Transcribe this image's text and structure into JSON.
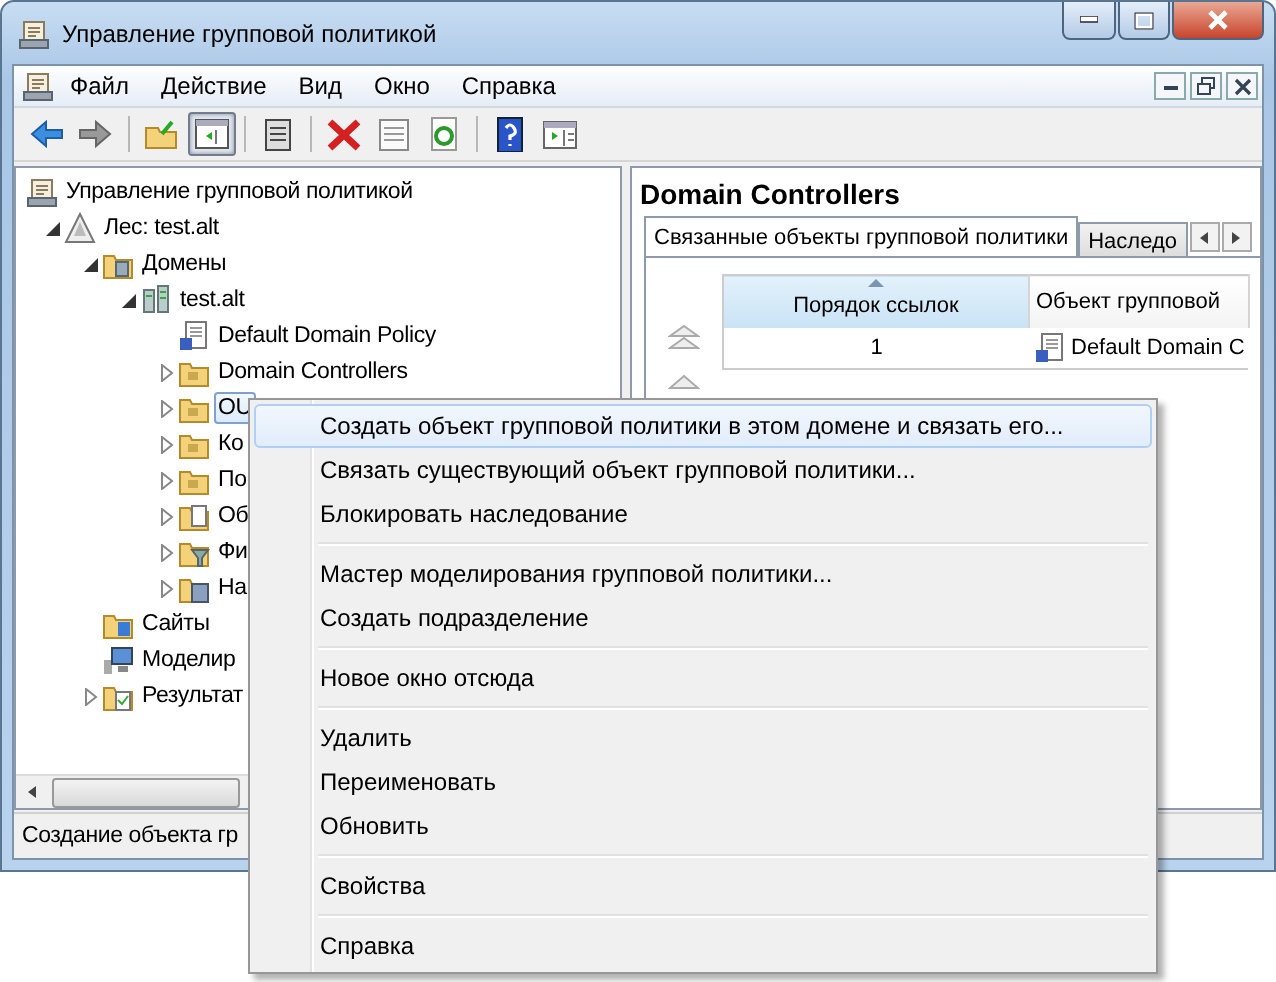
{
  "window": {
    "title": "Управление групповой политикой"
  },
  "menu_bar": [
    "Файл",
    "Действие",
    "Вид",
    "Окно",
    "Справка"
  ],
  "toolbar": [
    {
      "kind": "back",
      "pressed": false
    },
    {
      "kind": "forward",
      "pressed": false
    },
    {
      "kind": "up",
      "pressed": false
    },
    {
      "kind": "tree",
      "pressed": true
    },
    {
      "kind": "clipboard",
      "pressed": false
    },
    {
      "kind": "delete",
      "pressed": false
    },
    {
      "kind": "properties",
      "pressed": false
    },
    {
      "kind": "refresh",
      "pressed": false
    },
    {
      "kind": "help",
      "pressed": false
    },
    {
      "kind": "action-pane",
      "pressed": false
    }
  ],
  "tree": [
    {
      "label": "Управление групповой политикой",
      "kind": "console",
      "selected": false,
      "children": [
        {
          "label": "Лес: test.alt",
          "kind": "forest",
          "selected": false,
          "expanded": true,
          "children": [
            {
              "label": "Домены",
              "kind": "domains",
              "selected": false,
              "expanded": true,
              "children": [
                {
                  "label": "test.alt",
                  "kind": "domain",
                  "selected": false,
                  "expanded": true,
                  "children": [
                    {
                      "label": "Default Domain Policy",
                      "kind": "gpo",
                      "selected": false
                    },
                    {
                      "label": "Domain Controllers",
                      "kind": "ou",
                      "selected": false,
                      "expanded": false
                    },
                    {
                      "label": "OU",
                      "kind": "ou",
                      "selected": true,
                      "expanded": false
                    },
                    {
                      "label": "Ко",
                      "kind": "ou",
                      "selected": false,
                      "expanded": false
                    },
                    {
                      "label": "По",
                      "kind": "ou",
                      "selected": false,
                      "expanded": false
                    },
                    {
                      "label": "Об",
                      "kind": "doc-folder",
                      "selected": false,
                      "expanded": false
                    },
                    {
                      "label": "Фи",
                      "kind": "filter-folder",
                      "selected": false,
                      "expanded": false
                    },
                    {
                      "label": "На",
                      "kind": "wmi-folder",
                      "selected": false,
                      "expanded": false
                    }
                  ]
                }
              ]
            },
            {
              "label": "Сайты",
              "kind": "sites",
              "selected": false
            },
            {
              "label": "Моделир",
              "kind": "modeling",
              "selected": false
            },
            {
              "label": "Результат",
              "kind": "results",
              "selected": false,
              "expanded": false
            }
          ]
        }
      ]
    }
  ],
  "details": {
    "heading": "Domain Controllers",
    "tabs": [
      {
        "label": "Связанные объекты групповой политики",
        "selected": true
      },
      {
        "label": "Наследо",
        "selected": false
      }
    ],
    "columns": [
      {
        "label": "Порядок ссылок",
        "sorted": true
      },
      {
        "label": "Объект групповой",
        "sorted": false
      }
    ],
    "rows": [
      [
        "1",
        "Default Domain C"
      ]
    ]
  },
  "status_bar": "Создание объекта гр",
  "context_menu": [
    [
      {
        "label": "Создать объект групповой политики в этом домене и связать его...",
        "selected": true
      },
      {
        "label": "Связать существующий объект групповой политики...",
        "selected": false
      },
      {
        "label": "Блокировать наследование",
        "selected": false
      }
    ],
    [
      {
        "label": "Мастер моделирования групповой политики...",
        "selected": false
      },
      {
        "label": "Создать подразделение",
        "selected": false
      }
    ],
    [
      {
        "label": "Новое окно отсюда",
        "selected": false
      }
    ],
    [
      {
        "label": "Удалить",
        "selected": false
      },
      {
        "label": "Переименовать",
        "selected": false
      },
      {
        "label": "Обновить",
        "selected": false
      }
    ],
    [
      {
        "label": "Свойства",
        "selected": false
      }
    ],
    [
      {
        "label": "Справка",
        "selected": false
      }
    ]
  ]
}
